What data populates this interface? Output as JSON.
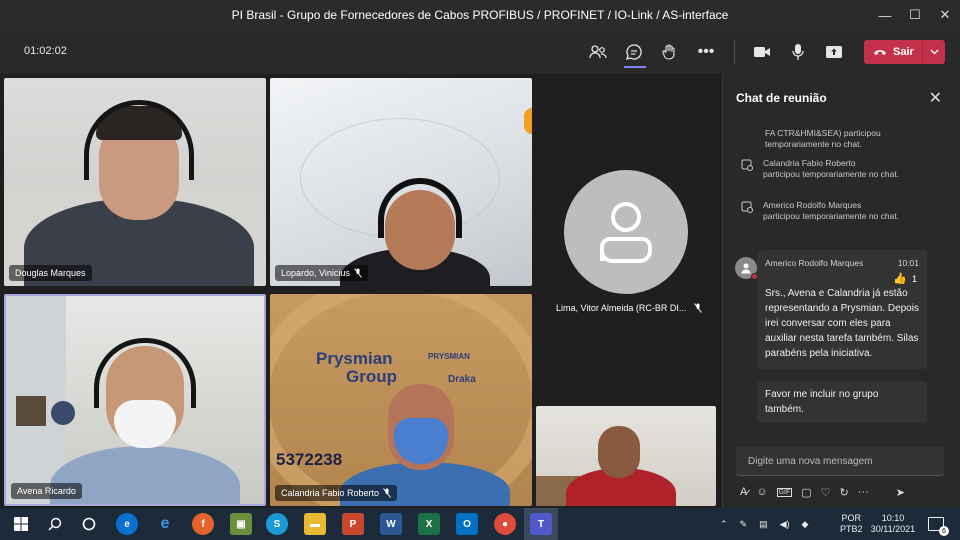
{
  "window": {
    "title": "PI Brasil - Grupo de Fornecedores de Cabos PROFIBUS / PROFINET / IO-Link / AS-interface",
    "minimize": "—",
    "maximize": "☐",
    "close": "✕"
  },
  "toolbar": {
    "timer": "01:02:02",
    "leave_label": "Sair"
  },
  "participants": [
    {
      "name": "Douglas Marques",
      "muted": false
    },
    {
      "name": "Lopardo, Vinicius",
      "muted": true
    },
    {
      "name": "Lima, Vitor Almeida (RC-BR DI...",
      "muted": true
    },
    {
      "name": "Avena Ricardo",
      "muted": false
    },
    {
      "name": "Calandria Fabio Roberto",
      "muted": true
    }
  ],
  "background_text": {
    "brand_line1": "Prysmian",
    "brand_line2": "Group",
    "brand_small1": "PRYSMIAN",
    "brand_small2": "Draka",
    "number": "5372238"
  },
  "chat": {
    "title": "Chat de reunião",
    "system_messages": [
      {
        "name": "",
        "text": "FA CTR&HMI&SEA) participou temporariamente no chat."
      },
      {
        "name": "Calandria Fabio Roberto",
        "text": "participou temporariamente no chat."
      },
      {
        "name": "Americo Rodolfo Marques",
        "text": "participou temporariamente no chat."
      }
    ],
    "message": {
      "author": "Americo Rodolfo Marques",
      "time": "10:01",
      "reaction_count": "1",
      "text": "Srs., Avena e Calandria já estão representando a Prysmian. Depois irei conversar com eles para auxiliar nesta tarefa também. Silas parabéns pela iniciativa.",
      "followup": "Favor me incluir no grupo também."
    },
    "compose_placeholder": "Digite uma nova mensagem"
  },
  "taskbar": {
    "lang1": "POR",
    "lang2": "PTB2",
    "time": "10:10",
    "date": "30/11/2021",
    "notifications": "6"
  }
}
